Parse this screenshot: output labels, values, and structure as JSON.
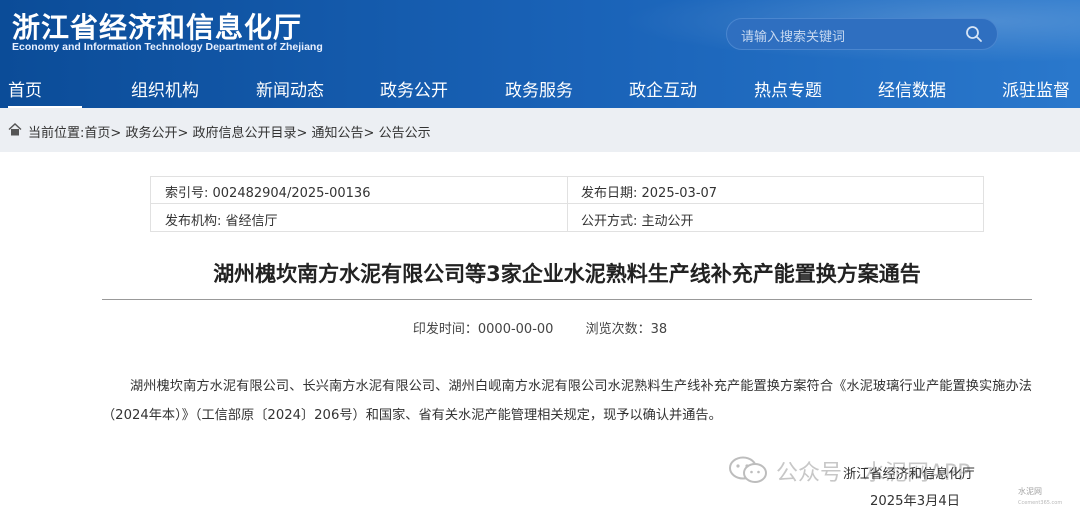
{
  "site": {
    "title_cn": "浙江省经济和信息化厅",
    "title_en": "Economy and Information Technology Department of Zhejiang",
    "search_placeholder": "请输入搜索关键词"
  },
  "nav": [
    {
      "label": "首页",
      "active": true
    },
    {
      "label": "组织机构"
    },
    {
      "label": "新闻动态"
    },
    {
      "label": "政务公开"
    },
    {
      "label": "政务服务"
    },
    {
      "label": "政企互动"
    },
    {
      "label": "热点专题"
    },
    {
      "label": "经信数据"
    },
    {
      "label": "派驻监督"
    }
  ],
  "breadcrumb": {
    "prefix": "当前位置:",
    "items": [
      "首页>",
      "政务公开>",
      "政府信息公开目录>",
      "通知公告>",
      "公告公示"
    ]
  },
  "info": {
    "index_no": "索引号: 002482904/2025-00136",
    "publish_date": "发布日期: 2025-03-07",
    "publisher": "发布机构: 省经信厅",
    "disclosure": "公开方式: 主动公开"
  },
  "article": {
    "title": "湖州槐坎南方水泥有限公司等3家企业水泥熟料生产线补充产能置换方案通告",
    "print_time": "印发时间：0000-00-00",
    "views": "浏览次数：38",
    "body": "湖州槐坎南方水泥有限公司、长兴南方水泥有限公司、湖州白岘南方水泥有限公司水泥熟料生产线补充产能置换方案符合《水泥玻璃行业产能置换实施办法（2024年本）》（工信部原〔2024〕206号）和国家、省有关水泥产能管理相关规定，现予以确认并通告。",
    "sign_org": "浙江省经济和信息化厅",
    "sign_date": "2025年3月4日"
  },
  "watermark": {
    "text": "公众号 · 水泥网APP",
    "corner_text": "水泥网",
    "corner_sub": "Ccement365.com"
  },
  "icons": {
    "search": "search-icon",
    "home": "home-icon",
    "wechat": "wechat-icon"
  }
}
